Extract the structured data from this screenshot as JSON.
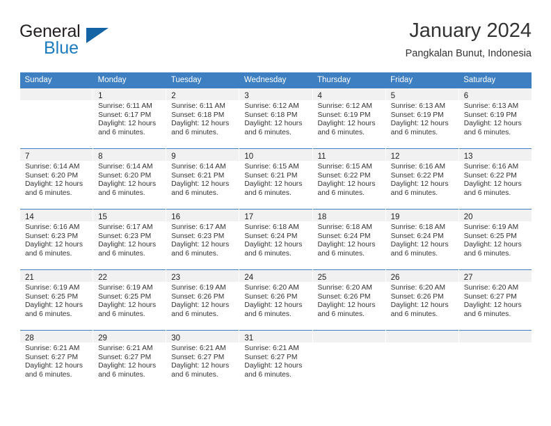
{
  "brand": {
    "name_part1": "General",
    "name_part2": "Blue",
    "triangle_icon": "triangle-icon",
    "colors": {
      "dark": "#231f20",
      "blue": "#1b7bbf",
      "triangle": "#1464a5"
    }
  },
  "header": {
    "title": "January 2024",
    "subtitle": "Pangkalan Bunut, Indonesia"
  },
  "theme": {
    "header_bg": "#3d7fc1",
    "header_text": "#ffffff",
    "daynum_band": "#f1f1f1",
    "grid_line": "#3d7fc1",
    "body_text": "#333333"
  },
  "weekdays": [
    "Sunday",
    "Monday",
    "Tuesday",
    "Wednesday",
    "Thursday",
    "Friday",
    "Saturday"
  ],
  "labels": {
    "sunrise": "Sunrise:",
    "sunset": "Sunset:",
    "daylight": "Daylight:"
  },
  "weeks": [
    [
      {
        "empty": true
      },
      {
        "day": "1",
        "sunrise": "Sunrise: 6:11 AM",
        "sunset": "Sunset: 6:17 PM",
        "daylight_line1": "Daylight: 12 hours",
        "daylight_line2": "and 6 minutes."
      },
      {
        "day": "2",
        "sunrise": "Sunrise: 6:11 AM",
        "sunset": "Sunset: 6:18 PM",
        "daylight_line1": "Daylight: 12 hours",
        "daylight_line2": "and 6 minutes."
      },
      {
        "day": "3",
        "sunrise": "Sunrise: 6:12 AM",
        "sunset": "Sunset: 6:18 PM",
        "daylight_line1": "Daylight: 12 hours",
        "daylight_line2": "and 6 minutes."
      },
      {
        "day": "4",
        "sunrise": "Sunrise: 6:12 AM",
        "sunset": "Sunset: 6:19 PM",
        "daylight_line1": "Daylight: 12 hours",
        "daylight_line2": "and 6 minutes."
      },
      {
        "day": "5",
        "sunrise": "Sunrise: 6:13 AM",
        "sunset": "Sunset: 6:19 PM",
        "daylight_line1": "Daylight: 12 hours",
        "daylight_line2": "and 6 minutes."
      },
      {
        "day": "6",
        "sunrise": "Sunrise: 6:13 AM",
        "sunset": "Sunset: 6:19 PM",
        "daylight_line1": "Daylight: 12 hours",
        "daylight_line2": "and 6 minutes."
      }
    ],
    [
      {
        "day": "7",
        "sunrise": "Sunrise: 6:14 AM",
        "sunset": "Sunset: 6:20 PM",
        "daylight_line1": "Daylight: 12 hours",
        "daylight_line2": "and 6 minutes."
      },
      {
        "day": "8",
        "sunrise": "Sunrise: 6:14 AM",
        "sunset": "Sunset: 6:20 PM",
        "daylight_line1": "Daylight: 12 hours",
        "daylight_line2": "and 6 minutes."
      },
      {
        "day": "9",
        "sunrise": "Sunrise: 6:14 AM",
        "sunset": "Sunset: 6:21 PM",
        "daylight_line1": "Daylight: 12 hours",
        "daylight_line2": "and 6 minutes."
      },
      {
        "day": "10",
        "sunrise": "Sunrise: 6:15 AM",
        "sunset": "Sunset: 6:21 PM",
        "daylight_line1": "Daylight: 12 hours",
        "daylight_line2": "and 6 minutes."
      },
      {
        "day": "11",
        "sunrise": "Sunrise: 6:15 AM",
        "sunset": "Sunset: 6:22 PM",
        "daylight_line1": "Daylight: 12 hours",
        "daylight_line2": "and 6 minutes."
      },
      {
        "day": "12",
        "sunrise": "Sunrise: 6:16 AM",
        "sunset": "Sunset: 6:22 PM",
        "daylight_line1": "Daylight: 12 hours",
        "daylight_line2": "and 6 minutes."
      },
      {
        "day": "13",
        "sunrise": "Sunrise: 6:16 AM",
        "sunset": "Sunset: 6:22 PM",
        "daylight_line1": "Daylight: 12 hours",
        "daylight_line2": "and 6 minutes."
      }
    ],
    [
      {
        "day": "14",
        "sunrise": "Sunrise: 6:16 AM",
        "sunset": "Sunset: 6:23 PM",
        "daylight_line1": "Daylight: 12 hours",
        "daylight_line2": "and 6 minutes."
      },
      {
        "day": "15",
        "sunrise": "Sunrise: 6:17 AM",
        "sunset": "Sunset: 6:23 PM",
        "daylight_line1": "Daylight: 12 hours",
        "daylight_line2": "and 6 minutes."
      },
      {
        "day": "16",
        "sunrise": "Sunrise: 6:17 AM",
        "sunset": "Sunset: 6:23 PM",
        "daylight_line1": "Daylight: 12 hours",
        "daylight_line2": "and 6 minutes."
      },
      {
        "day": "17",
        "sunrise": "Sunrise: 6:18 AM",
        "sunset": "Sunset: 6:24 PM",
        "daylight_line1": "Daylight: 12 hours",
        "daylight_line2": "and 6 minutes."
      },
      {
        "day": "18",
        "sunrise": "Sunrise: 6:18 AM",
        "sunset": "Sunset: 6:24 PM",
        "daylight_line1": "Daylight: 12 hours",
        "daylight_line2": "and 6 minutes."
      },
      {
        "day": "19",
        "sunrise": "Sunrise: 6:18 AM",
        "sunset": "Sunset: 6:24 PM",
        "daylight_line1": "Daylight: 12 hours",
        "daylight_line2": "and 6 minutes."
      },
      {
        "day": "20",
        "sunrise": "Sunrise: 6:19 AM",
        "sunset": "Sunset: 6:25 PM",
        "daylight_line1": "Daylight: 12 hours",
        "daylight_line2": "and 6 minutes."
      }
    ],
    [
      {
        "day": "21",
        "sunrise": "Sunrise: 6:19 AM",
        "sunset": "Sunset: 6:25 PM",
        "daylight_line1": "Daylight: 12 hours",
        "daylight_line2": "and 6 minutes."
      },
      {
        "day": "22",
        "sunrise": "Sunrise: 6:19 AM",
        "sunset": "Sunset: 6:25 PM",
        "daylight_line1": "Daylight: 12 hours",
        "daylight_line2": "and 6 minutes."
      },
      {
        "day": "23",
        "sunrise": "Sunrise: 6:19 AM",
        "sunset": "Sunset: 6:26 PM",
        "daylight_line1": "Daylight: 12 hours",
        "daylight_line2": "and 6 minutes."
      },
      {
        "day": "24",
        "sunrise": "Sunrise: 6:20 AM",
        "sunset": "Sunset: 6:26 PM",
        "daylight_line1": "Daylight: 12 hours",
        "daylight_line2": "and 6 minutes."
      },
      {
        "day": "25",
        "sunrise": "Sunrise: 6:20 AM",
        "sunset": "Sunset: 6:26 PM",
        "daylight_line1": "Daylight: 12 hours",
        "daylight_line2": "and 6 minutes."
      },
      {
        "day": "26",
        "sunrise": "Sunrise: 6:20 AM",
        "sunset": "Sunset: 6:26 PM",
        "daylight_line1": "Daylight: 12 hours",
        "daylight_line2": "and 6 minutes."
      },
      {
        "day": "27",
        "sunrise": "Sunrise: 6:20 AM",
        "sunset": "Sunset: 6:27 PM",
        "daylight_line1": "Daylight: 12 hours",
        "daylight_line2": "and 6 minutes."
      }
    ],
    [
      {
        "day": "28",
        "sunrise": "Sunrise: 6:21 AM",
        "sunset": "Sunset: 6:27 PM",
        "daylight_line1": "Daylight: 12 hours",
        "daylight_line2": "and 6 minutes."
      },
      {
        "day": "29",
        "sunrise": "Sunrise: 6:21 AM",
        "sunset": "Sunset: 6:27 PM",
        "daylight_line1": "Daylight: 12 hours",
        "daylight_line2": "and 6 minutes."
      },
      {
        "day": "30",
        "sunrise": "Sunrise: 6:21 AM",
        "sunset": "Sunset: 6:27 PM",
        "daylight_line1": "Daylight: 12 hours",
        "daylight_line2": "and 6 minutes."
      },
      {
        "day": "31",
        "sunrise": "Sunrise: 6:21 AM",
        "sunset": "Sunset: 6:27 PM",
        "daylight_line1": "Daylight: 12 hours",
        "daylight_line2": "and 6 minutes."
      },
      {
        "empty": true
      },
      {
        "empty": true
      },
      {
        "empty": true
      }
    ]
  ]
}
